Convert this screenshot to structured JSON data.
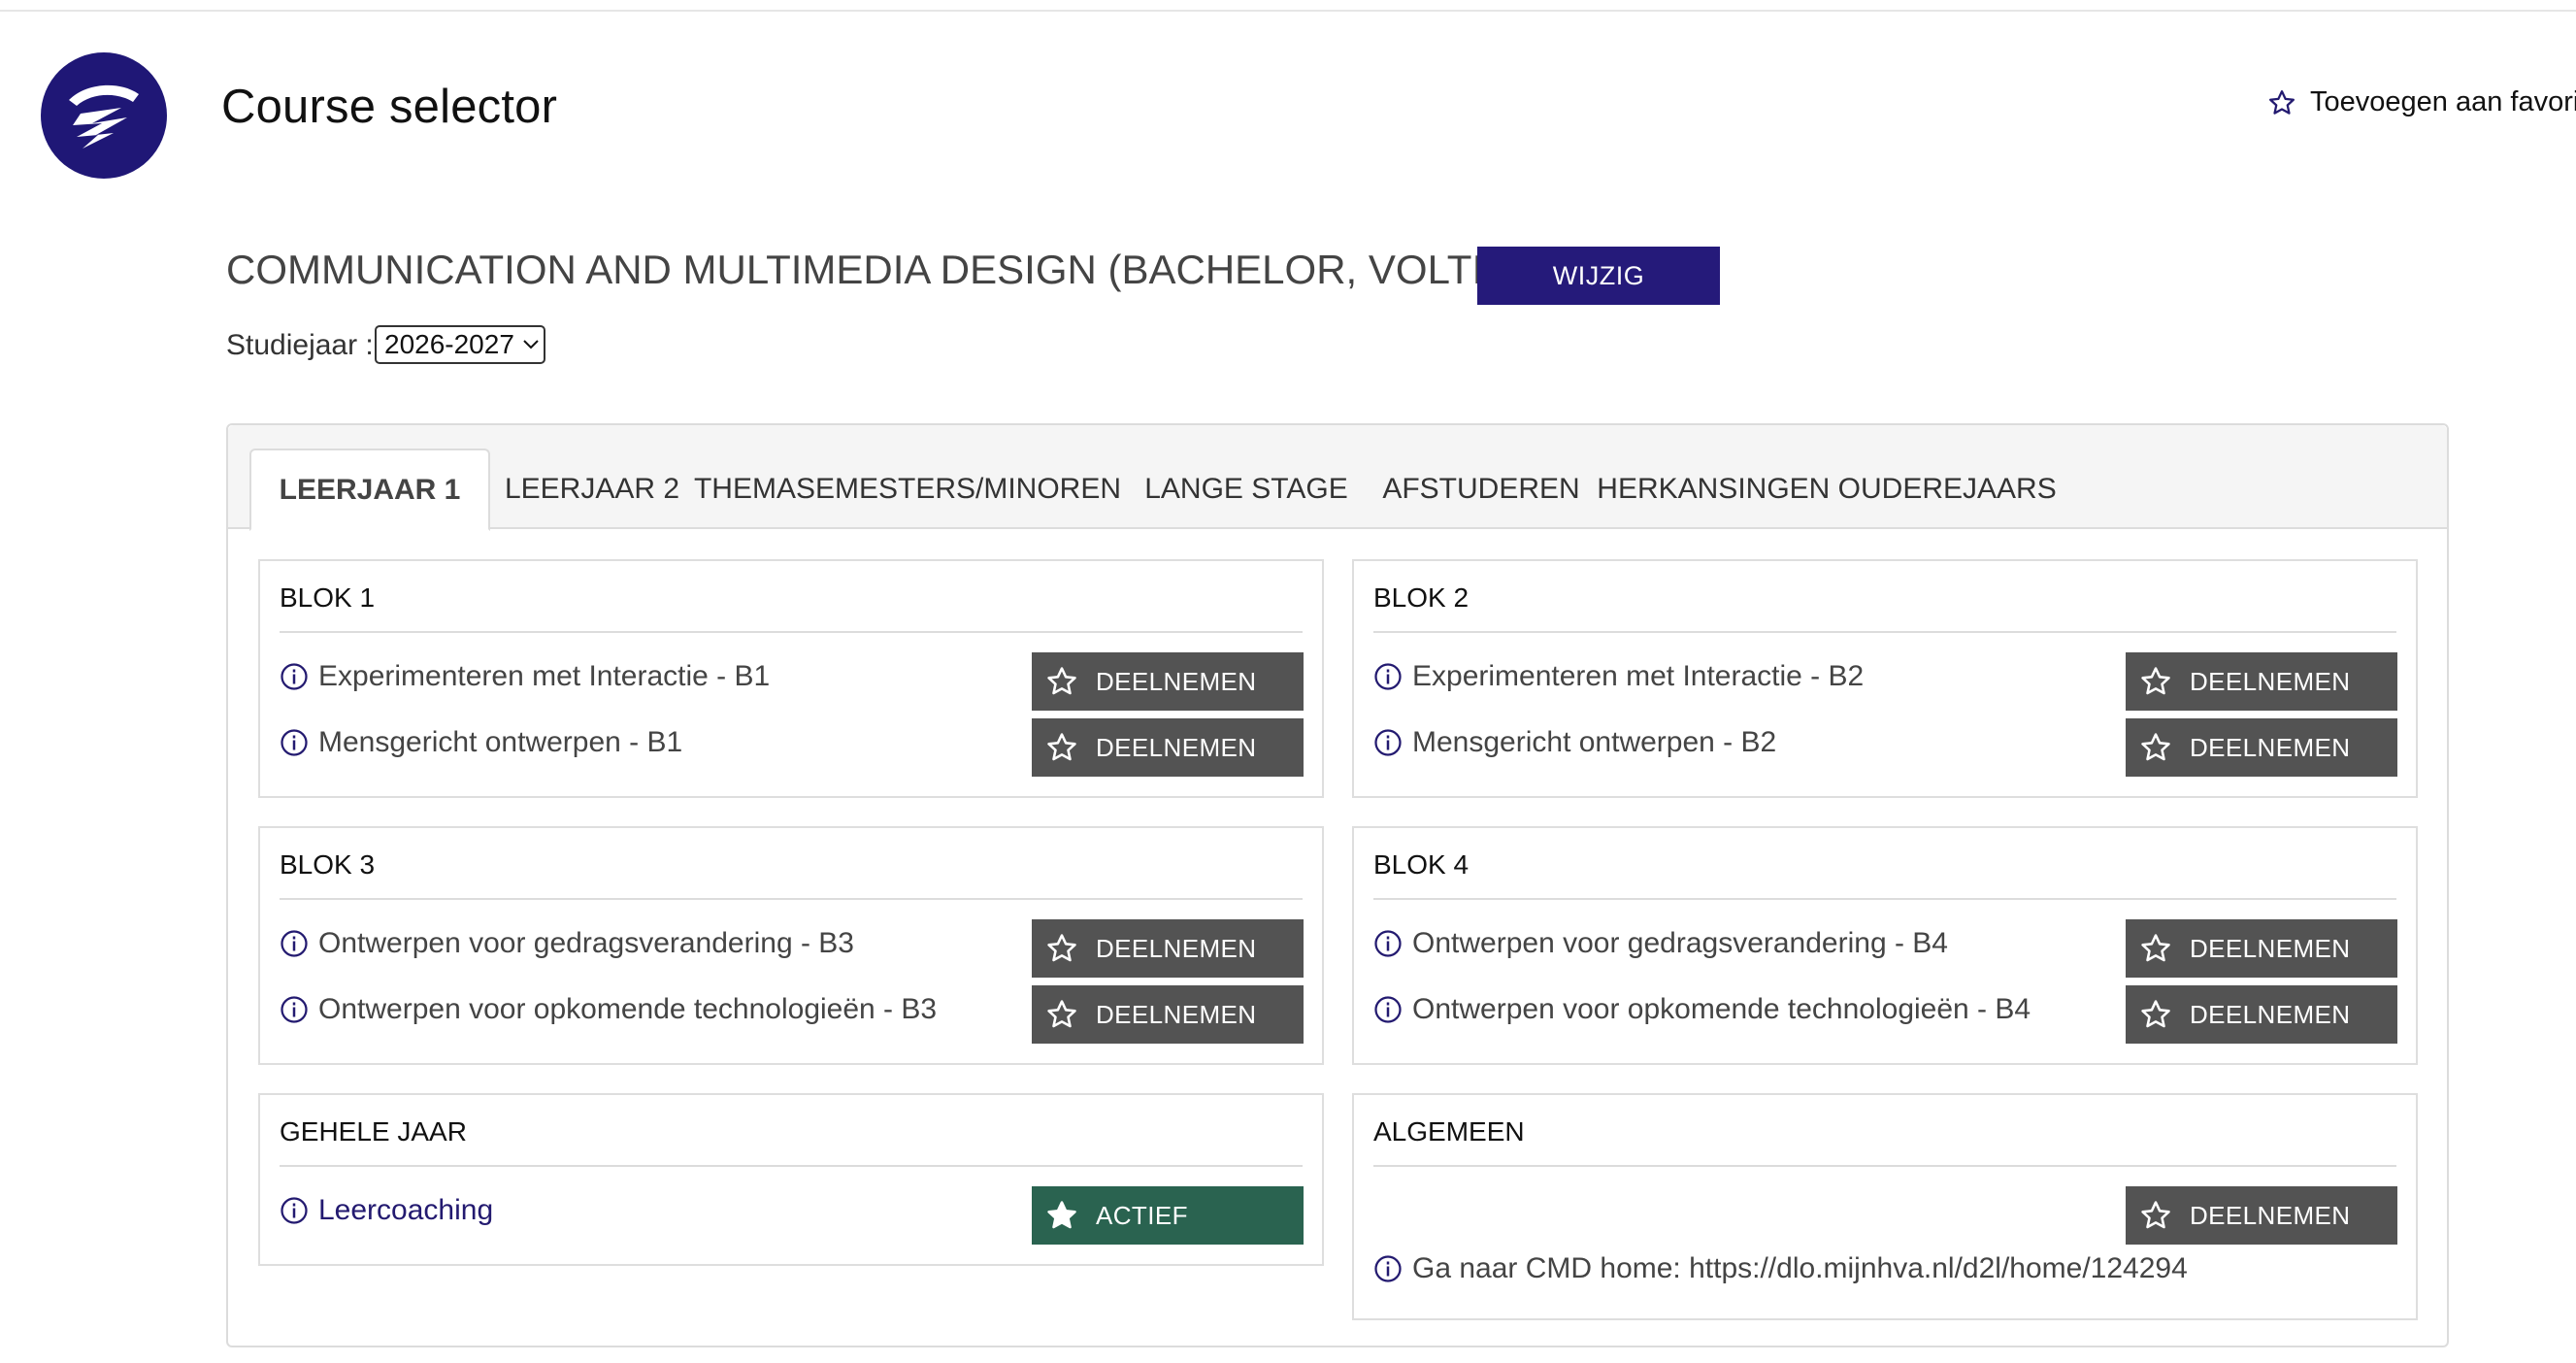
{
  "header": {
    "app_title": "Course selector",
    "favorite_label": "Toevoegen aan favorie",
    "logo": "hva-logo",
    "brand_color": "#1f1776"
  },
  "program": {
    "title": "COMMUNICATION AND MULTIMEDIA DESIGN (BACHELOR, VOLTIJD)",
    "change_label": "WIJZIG"
  },
  "year": {
    "label": "Studiejaar :",
    "selected": "2026-2027"
  },
  "tabs": [
    {
      "label": "LEERJAAR 1",
      "active": true
    },
    {
      "label": "LEERJAAR 2",
      "active": false
    },
    {
      "label": "THEMASEMESTERS/MINOREN",
      "active": false
    },
    {
      "label": "LANGE STAGE",
      "active": false
    },
    {
      "label": "AFSTUDEREN",
      "active": false
    },
    {
      "label": "HERKANSINGEN OUDEREJAARS",
      "active": false
    }
  ],
  "blocks": [
    {
      "title": "BLOK 1",
      "courses": [
        {
          "name": "Experimenteren met Interactie - B1",
          "action": "DEELNEMEN"
        },
        {
          "name": "Mensgericht ontwerpen - B1",
          "action": "DEELNEMEN"
        }
      ]
    },
    {
      "title": "BLOK 2",
      "courses": [
        {
          "name": "Experimenteren met Interactie - B2",
          "action": "DEELNEMEN"
        },
        {
          "name": "Mensgericht ontwerpen - B2",
          "action": "DEELNEMEN"
        }
      ]
    },
    {
      "title": "BLOK 3",
      "courses": [
        {
          "name": "Ontwerpen voor gedragsverandering - B3",
          "action": "DEELNEMEN"
        },
        {
          "name": "Ontwerpen voor opkomende technologieën - B3",
          "action": "DEELNEMEN"
        }
      ]
    },
    {
      "title": "BLOK 4",
      "courses": [
        {
          "name": "Ontwerpen voor gedragsverandering - B4",
          "action": "DEELNEMEN"
        },
        {
          "name": "Ontwerpen voor opkomende technologieën - B4",
          "action": "DEELNEMEN"
        }
      ]
    },
    {
      "title": "GEHELE JAAR",
      "courses": [
        {
          "name": "Leercoaching",
          "action": "ACTIEF"
        }
      ]
    },
    {
      "title": "ALGEMEEN",
      "action": "DEELNEMEN",
      "link_text": "Ga naar CMD home: https://dlo.mijnhva.nl/d2l/home/124294"
    }
  ],
  "colors": {
    "button_dark": "#535353",
    "button_active": "#2a6350",
    "change_button": "#251a7a"
  }
}
